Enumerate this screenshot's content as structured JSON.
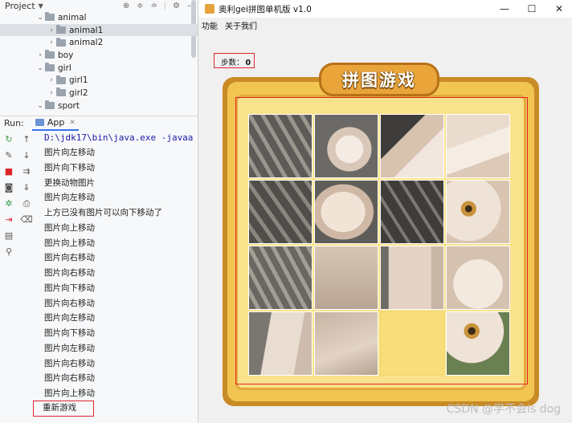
{
  "ide": {
    "project_label": "Project",
    "tree": [
      {
        "label": "animal",
        "indent": 1,
        "expanded": true
      },
      {
        "label": "animal1",
        "indent": 2,
        "expanded": false,
        "selected": true
      },
      {
        "label": "animal2",
        "indent": 2,
        "expanded": false
      },
      {
        "label": "boy",
        "indent": 1,
        "expanded": false
      },
      {
        "label": "girl",
        "indent": 1,
        "expanded": true
      },
      {
        "label": "girl1",
        "indent": 2,
        "expanded": false
      },
      {
        "label": "girl2",
        "indent": 2,
        "expanded": false
      },
      {
        "label": "sport",
        "indent": 1,
        "expanded": true
      }
    ],
    "run_label": "Run:",
    "run_tab": "App",
    "console": {
      "command": "D:\\jdk17\\bin\\java.exe -javaa",
      "lines": [
        "图片向左移动",
        "图片向下移动",
        "更换动物图片",
        "图片向左移动",
        "上方已没有图片可以向下移动了",
        "图片向上移动",
        "图片向上移动",
        "图片向右移动",
        "图片向右移动",
        "图片向下移动",
        "图片向右移动",
        "图片向左移动",
        "图片向下移动",
        "图片向左移动",
        "图片向右移动",
        "图片向右移动",
        "图片向上移动"
      ],
      "restart_line": "重新游戏"
    }
  },
  "game_window": {
    "title": "奥利gei拼图单机版 v1.0",
    "menu": [
      "功能",
      "关于我们"
    ],
    "steps_label": "步数：",
    "steps_value": "0",
    "banner": "拼图游戏",
    "tiles": [
      {
        "style": "kitten-slats-left"
      },
      {
        "style": "kitten-paw"
      },
      {
        "style": "kitten-ear-dark"
      },
      {
        "style": "kitten-ear-light"
      },
      {
        "style": "kitten-slats-dark"
      },
      {
        "style": "kitten-body"
      },
      {
        "style": "kitten-slats-mid"
      },
      {
        "style": "kitten-eye"
      },
      {
        "style": "kitten-slats-corner"
      },
      {
        "style": "kitten-fur"
      },
      {
        "style": "kitten-chest"
      },
      {
        "style": "kitten-chin"
      },
      {
        "style": "kitten-leg"
      },
      {
        "style": "kitten-fur-2"
      },
      {
        "style": "blank"
      },
      {
        "style": "kitten-eye-2"
      }
    ]
  },
  "watermark": "CSDN @学不会is dog",
  "colors": {
    "accent_red": "#e0262b",
    "frame_wood": "#c98b26",
    "frame_yellow": "#f2c552"
  }
}
